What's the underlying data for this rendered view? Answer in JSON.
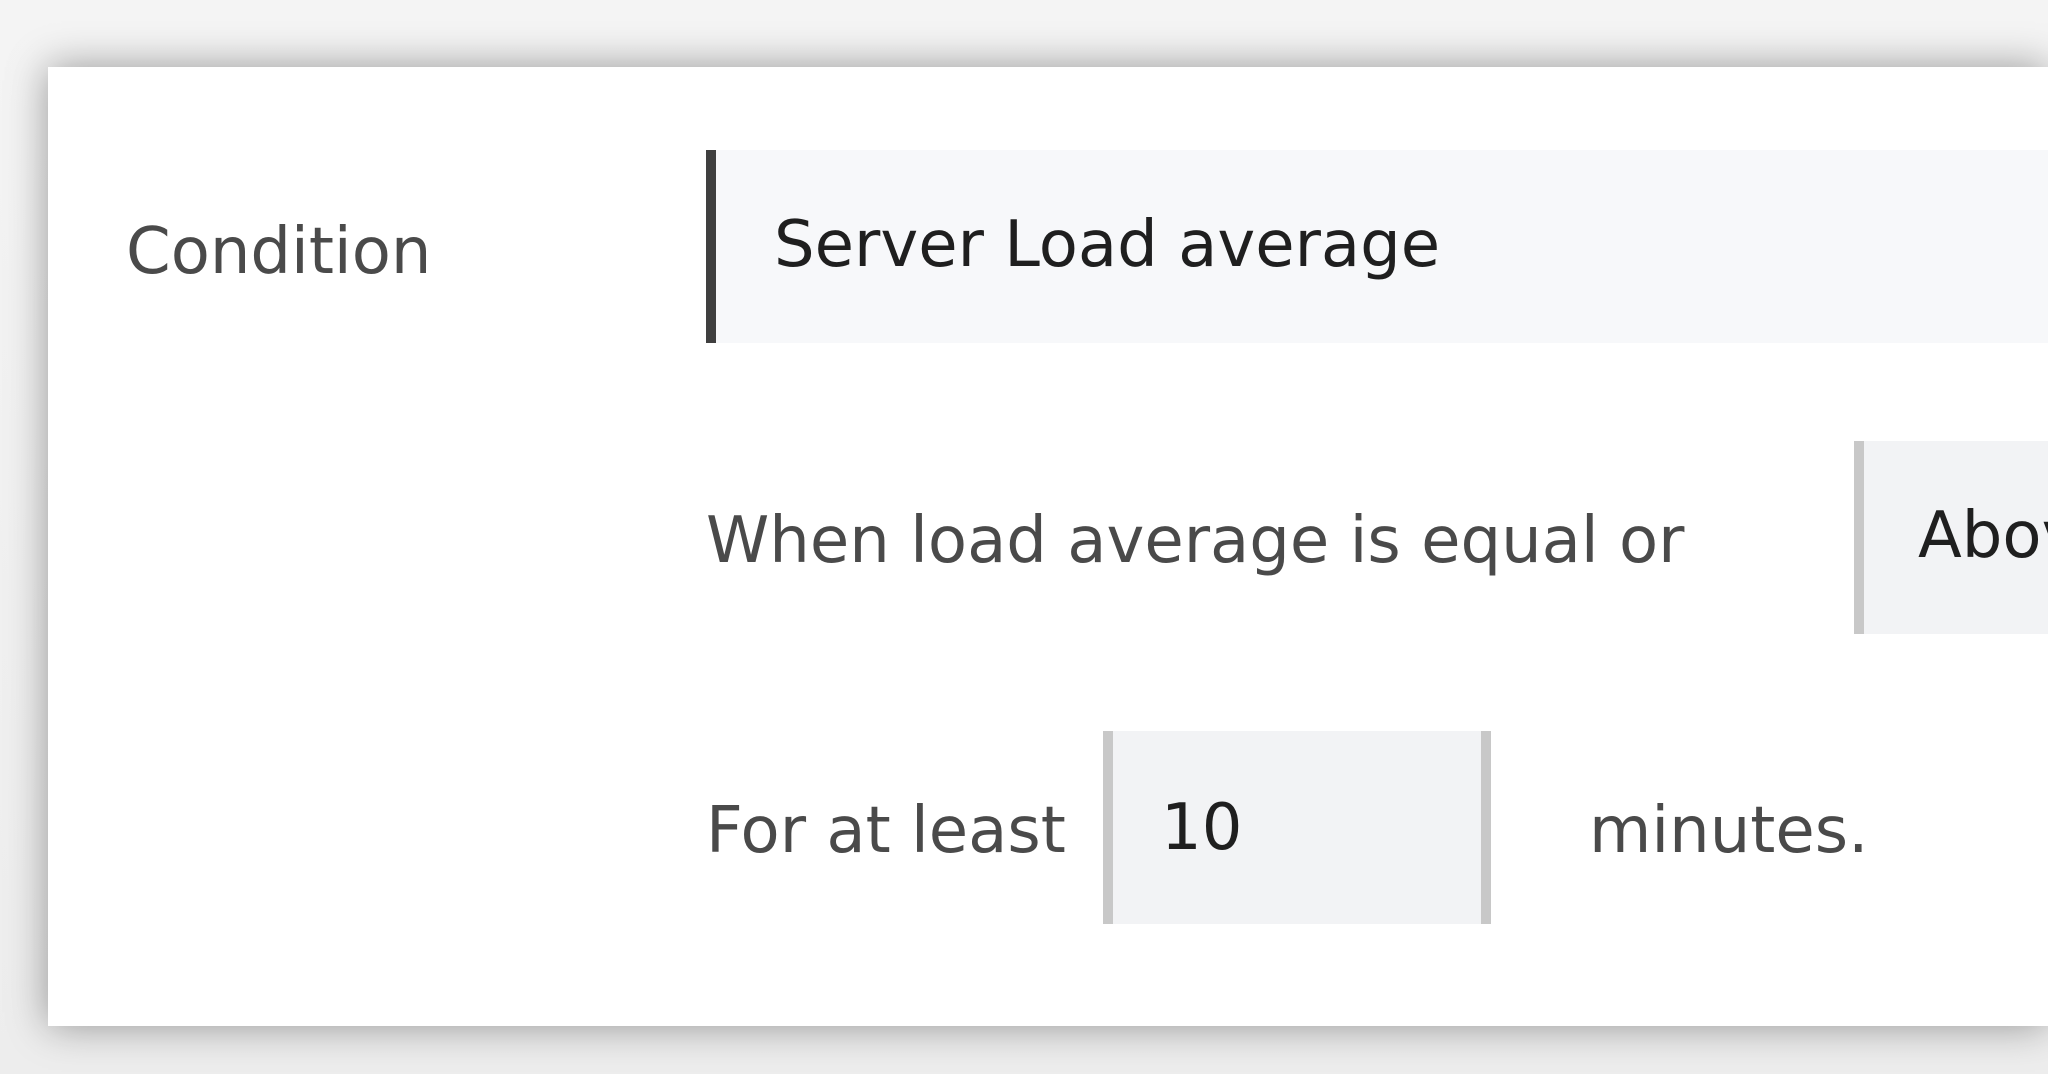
{
  "condition": {
    "label": "Condition",
    "metric": "Server Load average",
    "comparison_prefix": "When load average is equal or",
    "comparator_value": "Abov",
    "duration_prefix": "For at least",
    "duration_value": "10",
    "duration_suffix": "minutes."
  },
  "colors": {
    "accent_border": "#3f3f3f",
    "input_background": "#f2f3f5",
    "input_border": "#c8c8c8"
  }
}
